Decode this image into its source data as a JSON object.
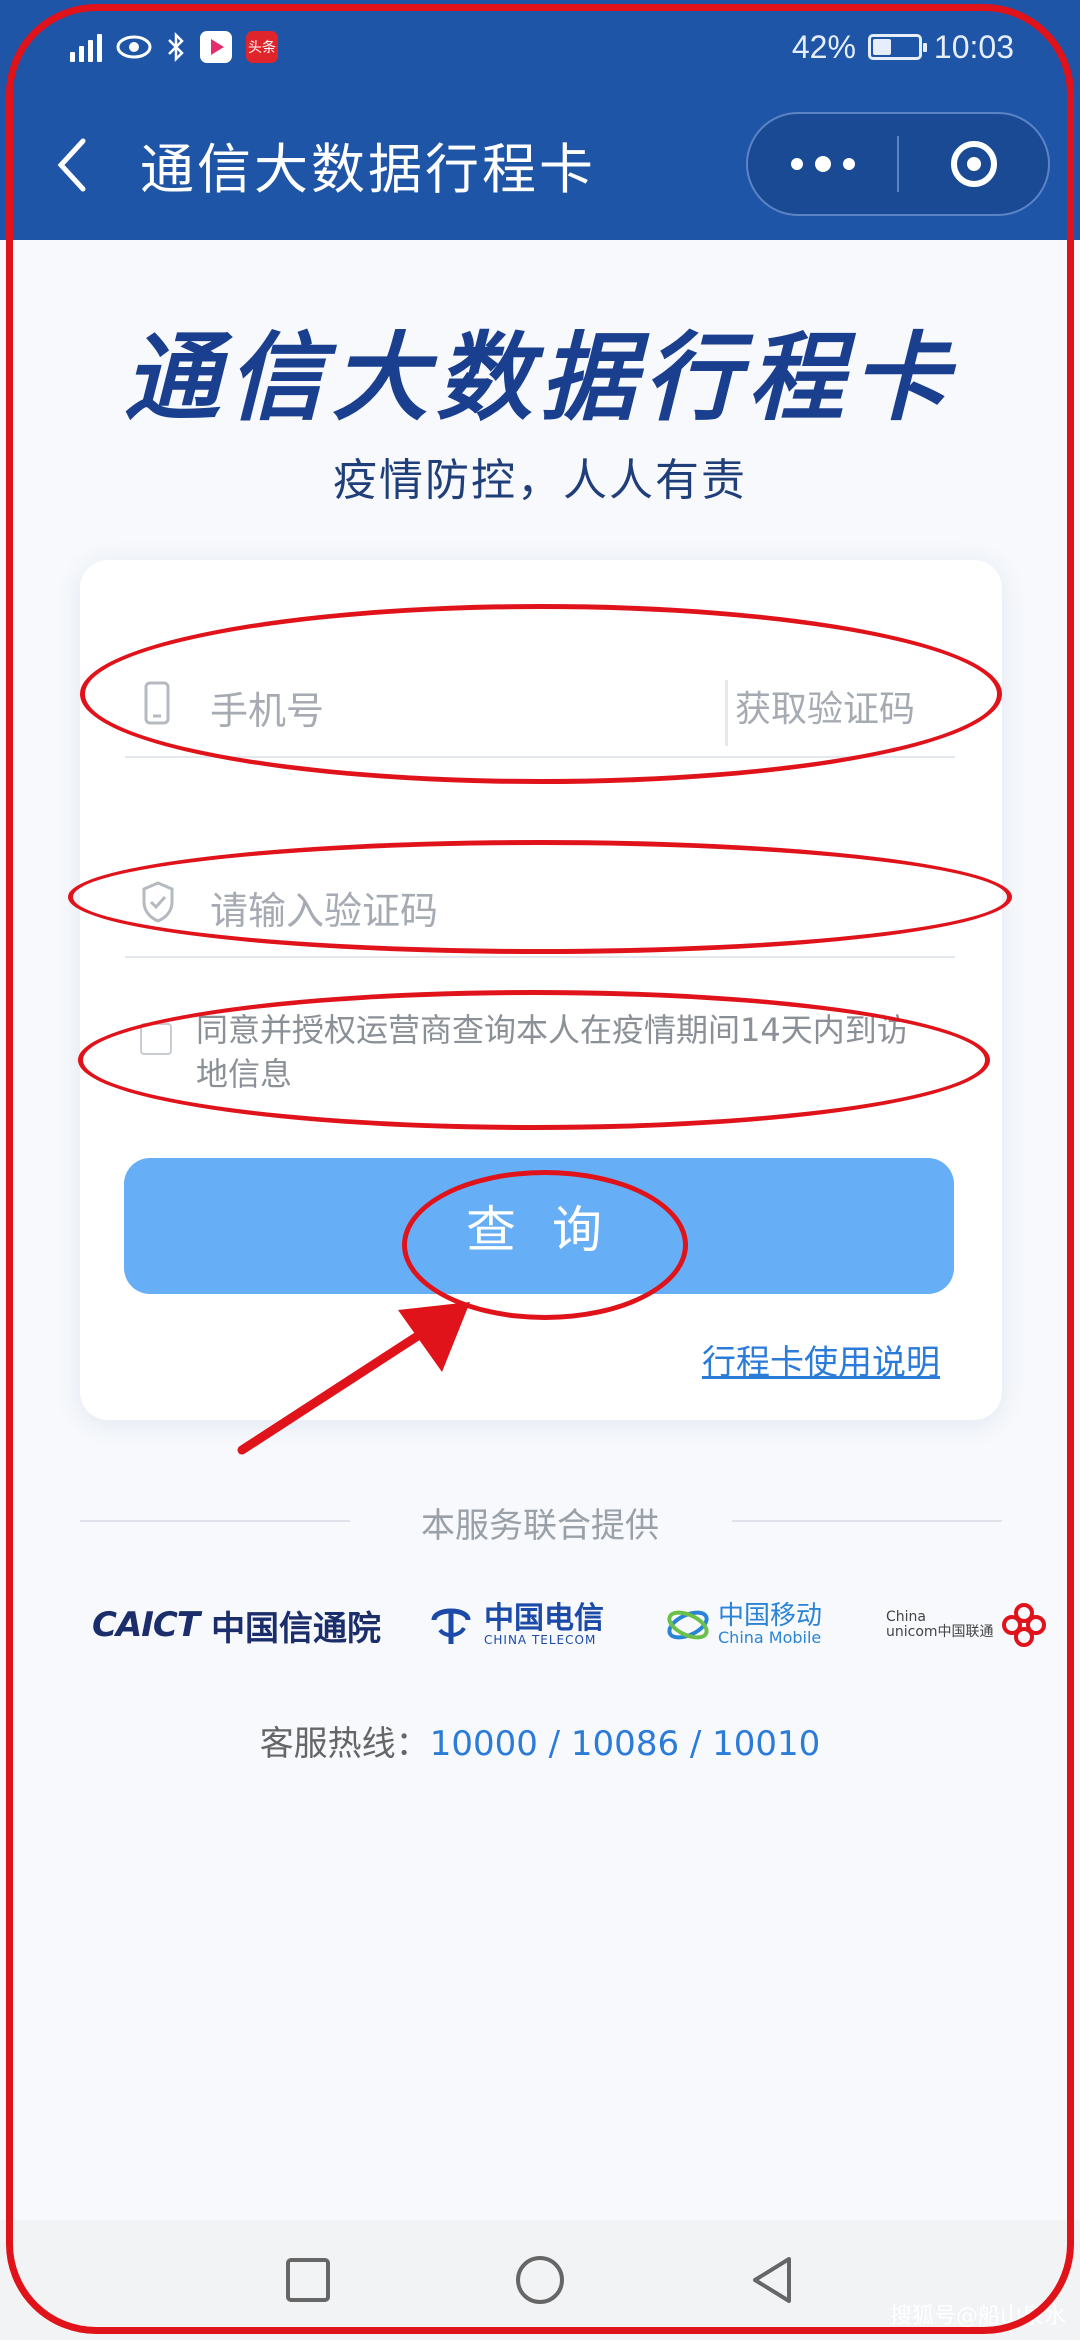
{
  "status_bar": {
    "battery": "42%",
    "battery_level": 0.42,
    "time": "10:03",
    "app_badge_2": "头条"
  },
  "nav_bar": {
    "title": "通信大数据行程卡"
  },
  "header": {
    "title": "通信大数据行程卡",
    "subtitle": "疫情防控，人人有责"
  },
  "form": {
    "phone_placeholder": "手机号",
    "get_code": "获取验证码",
    "code_placeholder": "请输入验证码",
    "agree_text": "同意并授权运营商查询本人在疫情期间14天内到访地信息",
    "query_button": "查 询",
    "guide_link": "行程卡使用说明"
  },
  "providers": {
    "label": "本服务联合提供",
    "caict_en": "CAICT",
    "caict_zh": "中国信通院",
    "telecom_zh": "中国电信",
    "telecom_en": "CHINA TELECOM",
    "mobile_zh": "中国移动",
    "mobile_en": "China Mobile",
    "unicom_en": "China",
    "unicom_zh": "unicom中国联通"
  },
  "hotline": {
    "label": "客服热线：",
    "numbers": "10000 / 10086 / 10010"
  },
  "watermark": "搜狐号@船山泉水",
  "colors": {
    "brand_blue": "#1f55a7",
    "button_blue": "#66aef6",
    "link_blue": "#2b7bd8",
    "annotation_red": "#e0121a"
  }
}
